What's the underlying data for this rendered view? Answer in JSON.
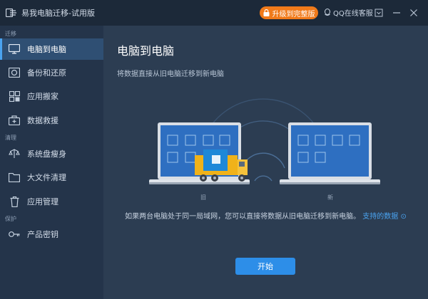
{
  "titlebar": {
    "title": "易我电脑迁移-试用版",
    "upgrade_label": "升级到完整版",
    "qq_label": "QQ在线客服"
  },
  "sidebar": {
    "sections": [
      {
        "label": "迁移"
      },
      {
        "label": "清理"
      },
      {
        "label": "保护"
      }
    ],
    "items": [
      {
        "label": "电脑到电脑",
        "icon": "monitor-icon",
        "active": true
      },
      {
        "label": "备份和还原",
        "icon": "backup-icon"
      },
      {
        "label": "应用搬家",
        "icon": "app-move-icon"
      },
      {
        "label": "数据救援",
        "icon": "rescue-icon"
      },
      {
        "label": "系统盘瘦身",
        "icon": "slim-icon"
      },
      {
        "label": "大文件清理",
        "icon": "folder-icon"
      },
      {
        "label": "应用管理",
        "icon": "trash-icon"
      },
      {
        "label": "产品密钥",
        "icon": "key-icon"
      }
    ]
  },
  "main": {
    "title": "电脑到电脑",
    "subtitle": "将数据直接从旧电脑迁移到新电脑",
    "old_label": "旧",
    "new_label": "新",
    "info_text": "如果两台电脑处于同一局域网，您可以直接将数据从旧电脑迁移到新电脑。",
    "info_link": "支持的数据",
    "start_label": "开始"
  },
  "colors": {
    "accent": "#2d8ee8",
    "upgrade": "#f07a1a",
    "sidebar_bg": "#24344a",
    "main_bg": "#2c3d52",
    "titlebar_bg": "#1c2939"
  }
}
